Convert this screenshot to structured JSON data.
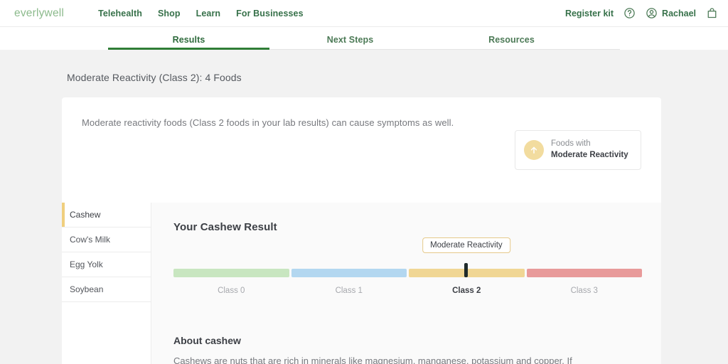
{
  "header": {
    "logo": "everlywell",
    "nav": [
      {
        "label": "Telehealth"
      },
      {
        "label": "Shop"
      },
      {
        "label": "Learn"
      },
      {
        "label": "For Businesses"
      }
    ],
    "register_kit": "Register kit",
    "help_icon": "help-circle-icon",
    "account_icon": "user-circle-icon",
    "user_name": "Rachael",
    "cart_icon": "shopping-bag-icon"
  },
  "tabs": [
    {
      "label": "Results",
      "active": true
    },
    {
      "label": "Next Steps",
      "active": false
    },
    {
      "label": "Resources",
      "active": false
    }
  ],
  "page_title": "Moderate Reactivity (Class 2): 4 Foods",
  "info_card": {
    "description": "Moderate reactivity foods (Class 2 foods in your lab results) can cause symptoms as well.",
    "legend": {
      "icon": "arrow-up-icon",
      "line1": "Foods with",
      "line2": "Moderate Reactivity",
      "circle_color": "#f2dc9f"
    }
  },
  "food_list": [
    {
      "label": "Cashew",
      "selected": true
    },
    {
      "label": "Cow's Milk",
      "selected": false
    },
    {
      "label": "Egg Yolk",
      "selected": false
    },
    {
      "label": "Soybean",
      "selected": false
    }
  ],
  "result": {
    "title": "Your Cashew Result",
    "tooltip": "Moderate Reactivity",
    "marker_class_index": 2,
    "marker_position_pct": 62.5,
    "scale": [
      {
        "label": "Class 0",
        "color": "#c8e6c0",
        "active": false
      },
      {
        "label": "Class 1",
        "color": "#b3d7f0",
        "active": false
      },
      {
        "label": "Class 2",
        "color": "#f0d694",
        "active": true
      },
      {
        "label": "Class 3",
        "color": "#e89a9a",
        "active": false
      }
    ]
  },
  "about": {
    "title": "About cashew",
    "body": "Cashews are nuts that are rich in minerals like magnesium, manganese, potassium and copper. If"
  }
}
